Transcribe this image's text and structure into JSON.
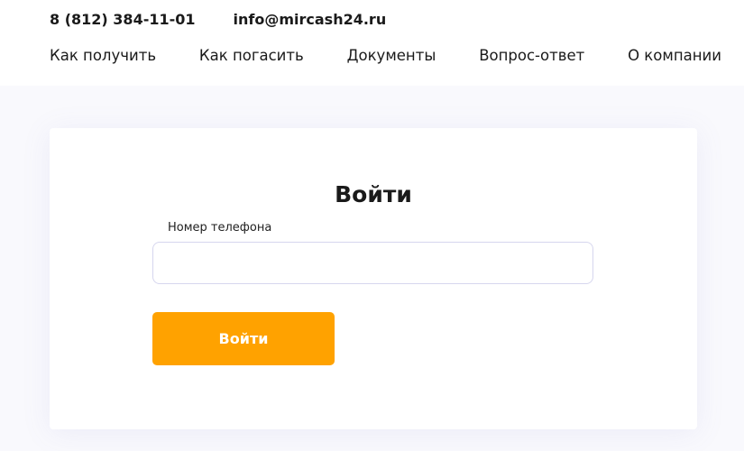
{
  "header": {
    "phone": "8 (812) 384-11-01",
    "email": "info@mircash24.ru"
  },
  "nav": {
    "items": [
      {
        "label": "Как получить"
      },
      {
        "label": "Как погасить"
      },
      {
        "label": "Документы"
      },
      {
        "label": "Вопрос-ответ"
      },
      {
        "label": "О компании"
      }
    ]
  },
  "login": {
    "title": "Войти",
    "phone_label": "Номер телефона",
    "phone_value": "",
    "phone_placeholder": "",
    "submit_label": "Войти"
  },
  "colors": {
    "accent": "#ffa200",
    "background": "#f9f9fd",
    "input_border": "#d6d6ee"
  }
}
